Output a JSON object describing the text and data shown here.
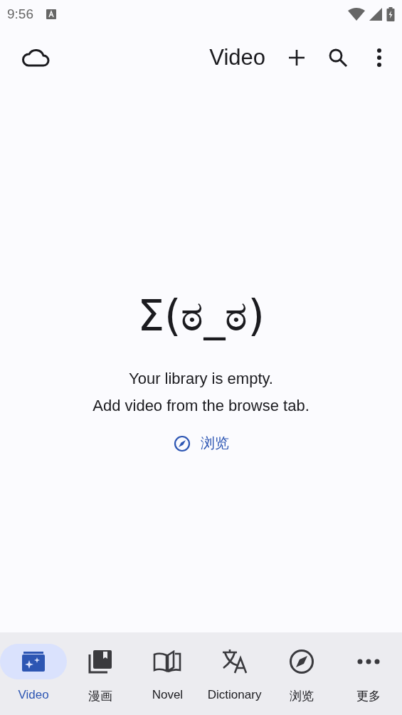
{
  "status_bar": {
    "time": "9:56"
  },
  "top_bar": {
    "title": "Video"
  },
  "empty_state": {
    "face": "Σ(ಠ_ಠ)",
    "message": "Your library is empty.\nAdd video from the browse tab.",
    "action": "浏览"
  },
  "nav": [
    {
      "label": "Video",
      "kind": "video",
      "selected": true
    },
    {
      "label": "漫画",
      "kind": "manga",
      "selected": false
    },
    {
      "label": "Novel",
      "kind": "novel",
      "selected": false
    },
    {
      "label": "Dictionary",
      "kind": "dictionary",
      "selected": false
    },
    {
      "label": "浏览",
      "kind": "browse",
      "selected": false
    },
    {
      "label": "更多",
      "kind": "more",
      "selected": false
    }
  ]
}
